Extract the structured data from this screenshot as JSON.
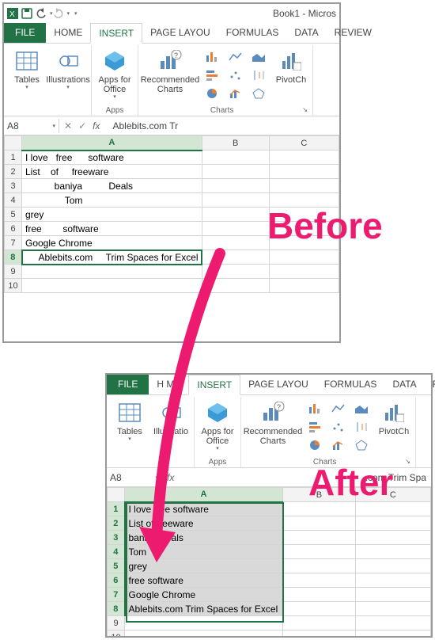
{
  "labels": {
    "before": "Before",
    "after": "After"
  },
  "common": {
    "window_title": "Book1 - Micros",
    "tabs": {
      "file": "FILE",
      "home": "HOME",
      "insert": "INSERT",
      "page_layout": "PAGE LAYOU",
      "formulas": "FORMULAS",
      "data": "DATA",
      "review": "REVIEW"
    },
    "ribbon": {
      "tables": "Tables",
      "illustrations": "Illustrations",
      "illustrations_short": "Illustratio",
      "apps_for_office": "Apps for Office",
      "apps_group": "Apps",
      "recommended_charts": "Recommended Charts",
      "charts_group": "Charts",
      "pivotchart": "PivotCh"
    },
    "namebox": "A8"
  },
  "before": {
    "formula_value": "     Ablebits.com     Tr",
    "colA_header": "A",
    "colB_header": "B",
    "colC_header": "C",
    "rows": [
      "I love   free      software",
      "List    of     freeware",
      "           baniya          Deals",
      "               Tom",
      "grey",
      "free        software",
      "Google Chrome",
      "     Ablebits.com     Trim Spaces for Excel"
    ]
  },
  "after": {
    "formula_value": ".com Trim Spa",
    "colA_header": "A",
    "colB_header": "B",
    "colC_header": "C",
    "rows": [
      "I love free software",
      "List of freeware",
      "baniya Deals",
      "Tom",
      "grey",
      "free software",
      "Google Chrome",
      "Ablebits.com Trim Spaces for Excel"
    ]
  }
}
